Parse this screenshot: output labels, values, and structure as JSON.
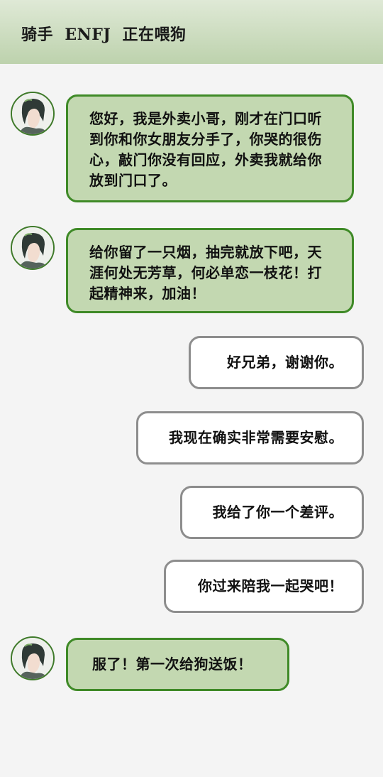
{
  "header": {
    "title": "骑手  ENFJ  正在喂狗"
  },
  "messages": [
    {
      "side": "incoming",
      "text": "您好，我是外卖小哥，刚才在门口听到你和你女朋友分手了，你哭的很伤心，敲门你没有回应，外卖我就给你放到门口了。"
    },
    {
      "side": "incoming",
      "text": "给你留了一只烟，抽完就放下吧，天涯何处无芳草，何必单恋一枝花！打起精神来，加油！"
    },
    {
      "side": "outgoing",
      "text": "好兄弟，谢谢你。"
    },
    {
      "side": "outgoing",
      "text": "我现在确实非常需要安慰。"
    },
    {
      "side": "outgoing",
      "text": "我给了你一个差评。"
    },
    {
      "side": "outgoing",
      "text": "你过来陪我一起哭吧！"
    },
    {
      "side": "incoming",
      "text": "服了！第一次给狗送饭！"
    }
  ],
  "colors": {
    "header_bg": "#c9dbbb",
    "incoming_bubble": "#c3d8b1",
    "incoming_border": "#3f8a27",
    "outgoing_bubble": "#ffffff",
    "outgoing_border": "#8d8d8d",
    "page_bg": "#f4f4f4"
  }
}
